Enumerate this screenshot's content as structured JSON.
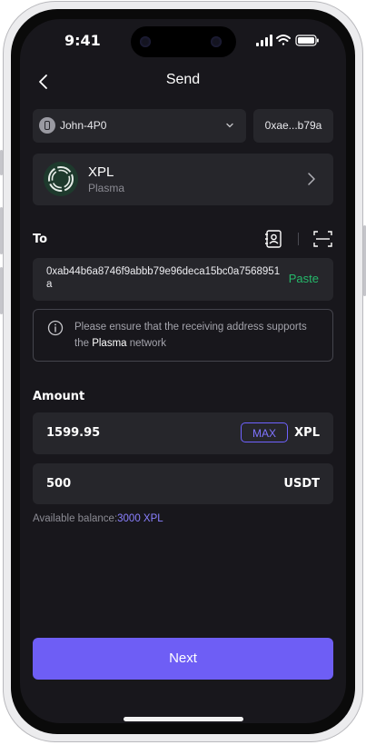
{
  "status_bar": {
    "time": "9:41",
    "icons": [
      "signal-icon",
      "wifi-icon",
      "battery-icon"
    ]
  },
  "header": {
    "title": "Send",
    "back_icon": "chevron-left-icon"
  },
  "wallet": {
    "name": "John-4P0",
    "dropdown_icon": "chevron-down-icon"
  },
  "address_chip": "0xae...b79a",
  "token": {
    "name": "XPL",
    "network": "Plasma"
  },
  "to": {
    "label": "To",
    "address": "0xab44b6a8746f9abbb79e96deca15bc0a7568951a",
    "paste_label": "Paste"
  },
  "notice": {
    "prefix": "Please ensure that the receiving address supports the",
    "network": "Plasma",
    "suffix": "network"
  },
  "amount": {
    "label": "Amount",
    "value": "1599.95",
    "max_label": "MAX",
    "unit": "XPL",
    "converted_value": "500",
    "converted_unit": "USDT"
  },
  "balance": {
    "label": "Available balance:",
    "value": "3000 XPL"
  },
  "next_label": "Next",
  "colors": {
    "accent": "#6e5ef5",
    "paste": "#25b86a",
    "background": "#18171c",
    "card": "#26262b"
  }
}
